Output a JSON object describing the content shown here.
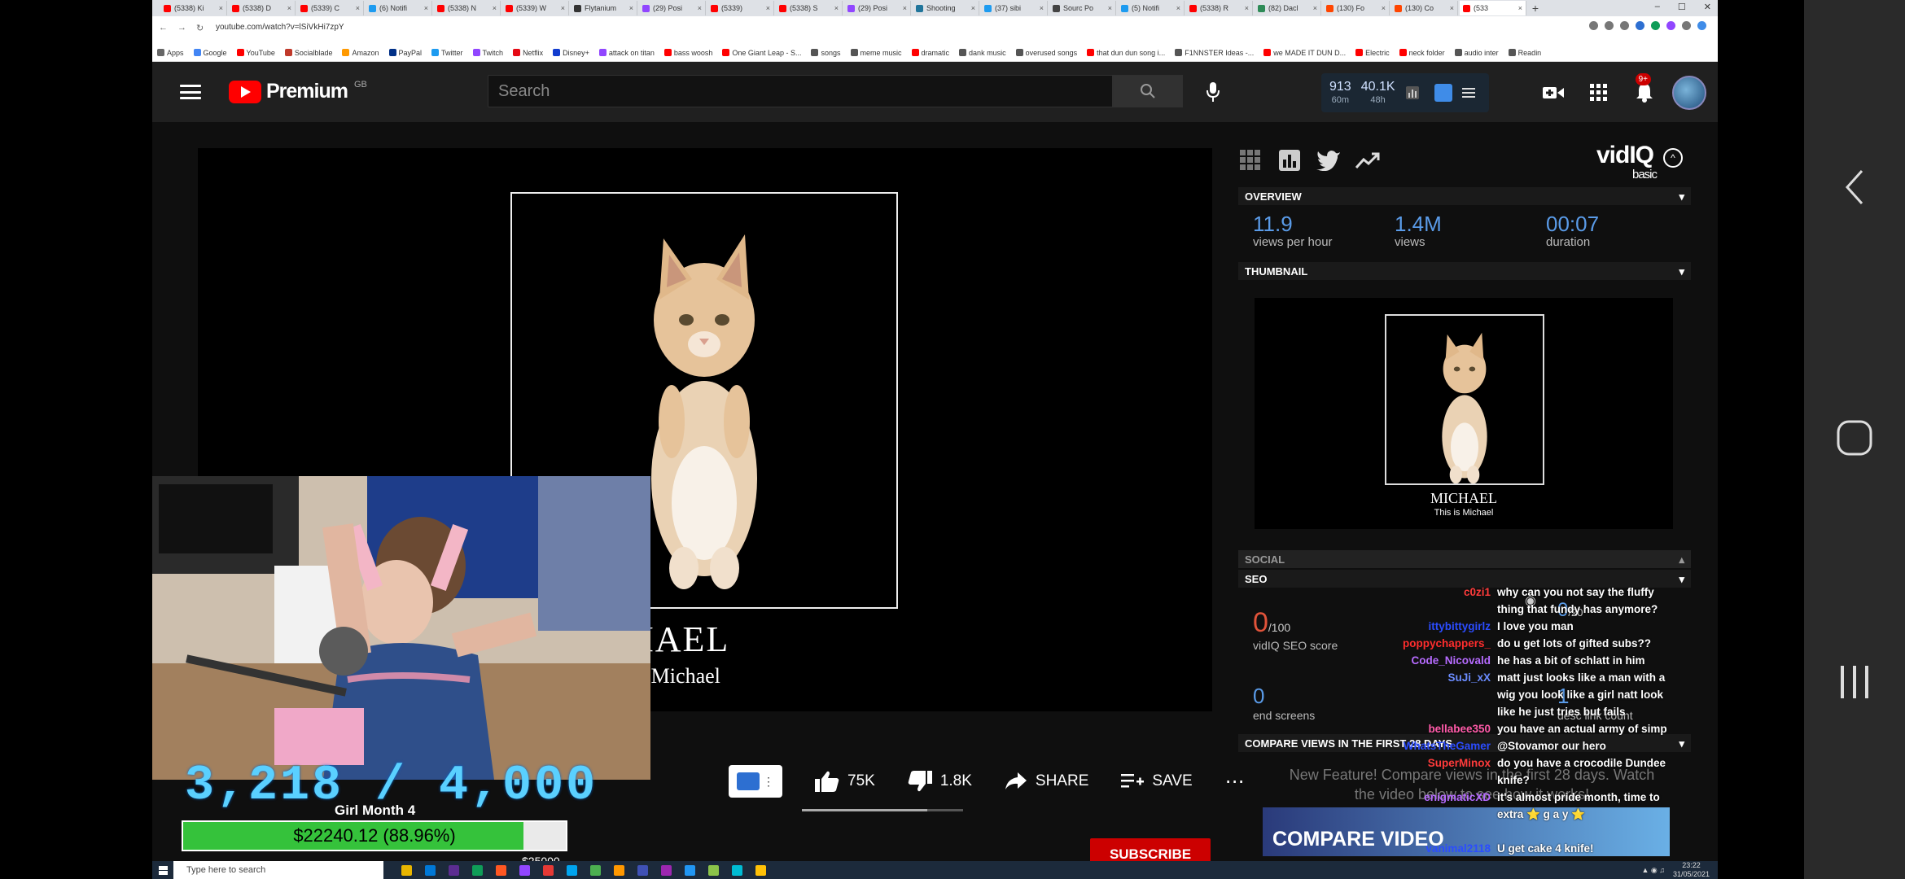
{
  "browser": {
    "tabs": [
      {
        "label": "(5338) Ki",
        "color": "#ff0000"
      },
      {
        "label": "(5338) D",
        "color": "#ff0000"
      },
      {
        "label": "(5339) C",
        "color": "#ff0000"
      },
      {
        "label": "(6) Notifi",
        "color": "#1d9bf0"
      },
      {
        "label": "(5338) N",
        "color": "#ff0000"
      },
      {
        "label": "(5339) W",
        "color": "#ff0000"
      },
      {
        "label": "Flytanium",
        "color": "#333333"
      },
      {
        "label": "(29) Posi",
        "color": "#9146ff"
      },
      {
        "label": "(5339) ",
        "color": "#ff0000"
      },
      {
        "label": "(5338) S",
        "color": "#ff0000"
      },
      {
        "label": "(29) Posi",
        "color": "#9146ff"
      },
      {
        "label": "Shooting",
        "color": "#21759b"
      },
      {
        "label": "(37) sibi",
        "color": "#1d9bf0"
      },
      {
        "label": "Sourc Po",
        "color": "#444444"
      },
      {
        "label": "(5) Notifi",
        "color": "#1d9bf0"
      },
      {
        "label": "(5338) R",
        "color": "#ff0000"
      },
      {
        "label": "(82) Dacl",
        "color": "#2e8b57"
      },
      {
        "label": "(130) Fo",
        "color": "#ff4500"
      },
      {
        "label": "(130) Co",
        "color": "#ff4500"
      },
      {
        "label": "(533 ",
        "color": "#ff0000"
      }
    ],
    "new_tab": "+",
    "window_controls": [
      "–",
      "☐",
      "✕"
    ],
    "url": "youtube.com/watch?v=lSiVkHi7zpY",
    "bookmarks": [
      {
        "label": "Apps",
        "color": "#666666"
      },
      {
        "label": "Google",
        "color": "#4285f4"
      },
      {
        "label": "YouTube",
        "color": "#ff0000"
      },
      {
        "label": "Socialblade",
        "color": "#c0392b"
      },
      {
        "label": "Amazon",
        "color": "#ff9900"
      },
      {
        "label": "PayPal",
        "color": "#003087"
      },
      {
        "label": "Twitter",
        "color": "#1d9bf0"
      },
      {
        "label": "Twitch",
        "color": "#9146ff"
      },
      {
        "label": "Netflix",
        "color": "#e50914"
      },
      {
        "label": "Disney+",
        "color": "#113ccf"
      },
      {
        "label": "attack on titan",
        "color": "#9146ff"
      },
      {
        "label": "bass woosh",
        "color": "#ff0000"
      },
      {
        "label": "One Giant Leap - S...",
        "color": "#ff0000"
      },
      {
        "label": "songs",
        "color": "#555555"
      },
      {
        "label": "meme music",
        "color": "#555555"
      },
      {
        "label": "dramatic",
        "color": "#ff0000"
      },
      {
        "label": "dank music",
        "color": "#555555"
      },
      {
        "label": "overused songs",
        "color": "#555555"
      },
      {
        "label": "that dun dun song i...",
        "color": "#ff0000"
      },
      {
        "label": "F1NNSTER Ideas -...",
        "color": "#555555"
      },
      {
        "label": "we MADE IT DUN D...",
        "color": "#ff0000"
      },
      {
        "label": "Electric",
        "color": "#ff0000"
      },
      {
        "label": "neck folder",
        "color": "#ff0000"
      },
      {
        "label": "audio inter",
        "color": "#555555"
      },
      {
        "label": "Readin",
        "color": "#555555"
      }
    ]
  },
  "youtube": {
    "brand": "Premium",
    "region": "GB",
    "search_placeholder": "Search",
    "vidiq_header": {
      "views_60m": "913",
      "label_60m": "60m",
      "views_48h": "40.1K",
      "label_48h": "48h"
    },
    "notification_count": "9+"
  },
  "video": {
    "title_text": "ICHAEL",
    "subtitle_text": "his is Michael",
    "likes": "75K",
    "dislikes": "1.8K",
    "like_ratio": 0.78,
    "share_label": "SHARE",
    "save_label": "SAVE",
    "more_label": "⋯",
    "subscribe_label": "SUBSCRIBE"
  },
  "stream_overlay": {
    "sub_count": "3,218 / 4,000",
    "sub_goal_label": "Girl Month 4",
    "donation_text": "$22240.12 (88.96%)",
    "donation_fraction": 0.8896,
    "donation_goal": "$25000"
  },
  "vidiq": {
    "logo": "vidIQ",
    "plan": "basic",
    "overview_label": "OVERVIEW",
    "views_per_hour": "11.9",
    "views_per_hour_label": "views per hour",
    "views": "1.4M",
    "views_label": "views",
    "duration": "00:07",
    "duration_label": "duration",
    "thumbnail_label": "THUMBNAIL",
    "thumb_title": "MICHAEL",
    "thumb_sub": "This is Michael",
    "social_label": "SOCIAL",
    "seo_label": "SEO",
    "seo_score": "0",
    "seo_score_max": "/100",
    "seo_score_label": "vidIQ SEO score",
    "tags_score": "0",
    "tags_max": "/20",
    "end_screens": "0",
    "end_screens_label": "end screens",
    "desc_links": "1",
    "desc_links_label": "desc link count",
    "compare_label": "COMPARE VIEWS IN THE FIRST 28 DAYS",
    "compare_note": "New Feature! Compare views in the first 28 days. Watch the video below to see how it works!",
    "compare_button": "COMPARE VIDEO"
  },
  "chat": [
    {
      "name": "c0zi1",
      "color": "#ff3b3b",
      "msg": "why can you not say the fluffy"
    },
    {
      "name": "",
      "color": "#ffffff",
      "msg": "thing that fundy has anymore?"
    },
    {
      "name": "ittybittygirlz",
      "color": "#2b4cff",
      "msg": "I love you man"
    },
    {
      "name": "poppychappers_",
      "color": "#ff2d2d",
      "msg": "do u get lots of gifted subs??"
    },
    {
      "name": "Code_Nicovald",
      "color": "#b66bff",
      "msg": "he has a bit of schlatt in him"
    },
    {
      "name": "SuJi_xX",
      "color": "#6b8cff",
      "msg": "matt just looks like a man with a"
    },
    {
      "name": "",
      "color": "#ffffff",
      "msg": "wig you look like a girl natt look"
    },
    {
      "name": "",
      "color": "#ffffff",
      "msg": "like he just tries but fails"
    },
    {
      "name": "bellabee350",
      "color": "#ff5aa8",
      "msg": "you have an actual army of simp"
    },
    {
      "name": "WhatsTheGamer",
      "color": "#2b4cff",
      "msg": "@Stovamor our hero"
    },
    {
      "name": "SuperMinox",
      "color": "#ff3b3b",
      "msg": "do you have a crocodile Dundee"
    },
    {
      "name": "",
      "color": "#ffffff",
      "msg": "knife?"
    },
    {
      "name": "enigmaticXD",
      "color": "#b66bff",
      "msg": "it's almost pride month, time to"
    },
    {
      "name": "",
      "color": "#ffffff",
      "msg": "extra ⭐ g a y ⭐"
    },
    {
      "name": "",
      "color": "#ffffff",
      "msg": ""
    },
    {
      "name": "vanimal2118",
      "color": "#2b4cff",
      "msg": "U get cake 4 knife!"
    }
  ],
  "taskbar": {
    "search_placeholder": "Type here to search",
    "time": "23:22",
    "date": "31/05/2021",
    "app_colors": [
      "#e8b500",
      "#0078d7",
      "#5c2d91",
      "#0f9d58",
      "#ff5722",
      "#9146ff",
      "#e53935",
      "#00a4ef",
      "#4caf50",
      "#ff9800",
      "#3f51b5",
      "#9c27b0",
      "#2196f3",
      "#8bc34a",
      "#00bcd4",
      "#ffc107"
    ]
  }
}
